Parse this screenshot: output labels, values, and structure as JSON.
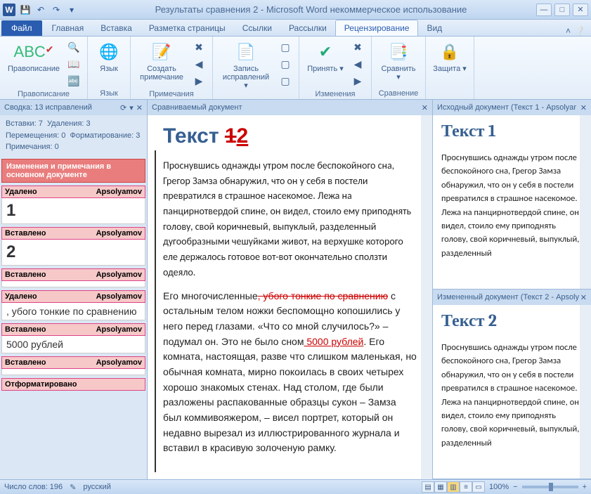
{
  "title": "Результаты сравнения 2 - Microsoft Word некоммерческое использование",
  "tabs": {
    "file": "Файл",
    "items": [
      "Главная",
      "Вставка",
      "Разметка страницы",
      "Ссылки",
      "Рассылки",
      "Рецензирование",
      "Вид"
    ],
    "active_index": 5
  },
  "ribbon": {
    "groups": [
      {
        "label": "Правописание",
        "buttons": [
          {
            "label": "Правописание",
            "icon": "✔"
          }
        ],
        "small": [
          "🔍",
          "📖",
          "📊",
          "🔤"
        ]
      },
      {
        "label": "Язык",
        "buttons": [
          {
            "label": "Язык",
            "icon": "🌐"
          }
        ]
      },
      {
        "label": "Примечания",
        "buttons": [
          {
            "label": "Создать примечание",
            "icon": "📝"
          }
        ],
        "small": [
          "✖",
          "◀",
          "▶"
        ]
      },
      {
        "label": "",
        "buttons": [
          {
            "label": "Запись исправлений ▾",
            "icon": "📄"
          }
        ],
        "small": [
          "▢",
          "▢",
          "▢"
        ]
      },
      {
        "label": "Изменения",
        "buttons": [
          {
            "label": "Принять ▾",
            "icon": "✔"
          }
        ],
        "small": [
          "✖",
          "◀",
          "▶"
        ]
      },
      {
        "label": "Сравнение",
        "buttons": [
          {
            "label": "Сравнить ▾",
            "icon": "📑"
          }
        ]
      },
      {
        "label": "",
        "buttons": [
          {
            "label": "Защита ▾",
            "icon": "🔒"
          }
        ]
      }
    ]
  },
  "summary": {
    "header": "Сводка: 13 исправлений",
    "line1a": "Вставки: 7",
    "line1b": "Удаления: 3",
    "line2a": "Перемещения: 0",
    "line2b": "Форматирование: 3",
    "line3": "Примечания: 0",
    "section_title": "Изменения и примечания в основном документе",
    "revisions": [
      {
        "type": "Удалено",
        "author": "Apsolyamov",
        "body": "1",
        "big": true
      },
      {
        "type": "Вставлено",
        "author": "Apsolyamov",
        "body": "2",
        "big": true
      },
      {
        "type": "Вставлено",
        "author": "Apsolyamov",
        "body": ""
      },
      {
        "type": "Удалено",
        "author": "Apsolyamov",
        "body": ", убого тонкие по сравнению"
      },
      {
        "type": "Вставлено",
        "author": "Apsolyamov",
        "body": " 5000 рублей"
      },
      {
        "type": "Вставлено",
        "author": "Apsolyamov",
        "body": ""
      },
      {
        "type": "Отформатировано",
        "author": "",
        "body": ""
      }
    ]
  },
  "center": {
    "header": "Сравниваемый документ",
    "title_prefix": "Текст ",
    "title_del": "1",
    "title_ins": "2",
    "p1": "Проснувшись однажды утром после беспокойного сна, Грегор Замза обнаружил, что он у себя в постели превратился в страшное насекомое. Лежа на панцирнотвердой спине, он видел, стоило ему приподнять голову, свой коричневый, выпуклый, разделенный дугообразными чешуйками живот, на верхушке которого еле держалось готовое вот-вот окончательно сползти одеяло.",
    "p2_a": "Его многочисленные",
    "p2_del": ", убого тонкие по сравнению",
    "p2_b": " с остальным телом ножки беспомощно копошились у него перед глазами. «Что со мной случилось?» – подумал он. Это не было сном",
    "p2_ins": " 5000 рублей",
    "p2_c": ". Его комната, настоящая, разве что слишком маленькая, но обычная комната, мирно покоилась в своих четырех хорошо знакомых стенах. Над столом, где были разложены распакованные образцы сукон – Замза был коммивояжером, – висел портрет, который он недавно вырезал из иллюстрированного журнала и вставил в красивую золоченую рамку."
  },
  "right1": {
    "header": "Исходный документ (Текст 1 - Apsolyar",
    "title": "Текст 1",
    "p": "Проснувшись однажды утром после беспокойного сна, Грегор Замза обнаружил, что он у себя в постели превратился в страшное насекомое. Лежа на панцирнотвердой спине, он видел, стоило ему приподнять голову, свой коричневый, выпуклый, разделенный"
  },
  "right2": {
    "header": "Измененный документ (Текст 2 - Apsoly",
    "title": "Текст 2",
    "p": "Проснувшись однажды утром после беспокойного сна, Грегор Замза обнаружил, что он у себя в постели превратился в страшное насекомое. Лежа на панцирнотвердой спине, он видел, стоило ему приподнять голову, свой коричневый, выпуклый, разделенный"
  },
  "status": {
    "words": "Число слов: 196",
    "lang": "русский",
    "zoom": "100%"
  }
}
